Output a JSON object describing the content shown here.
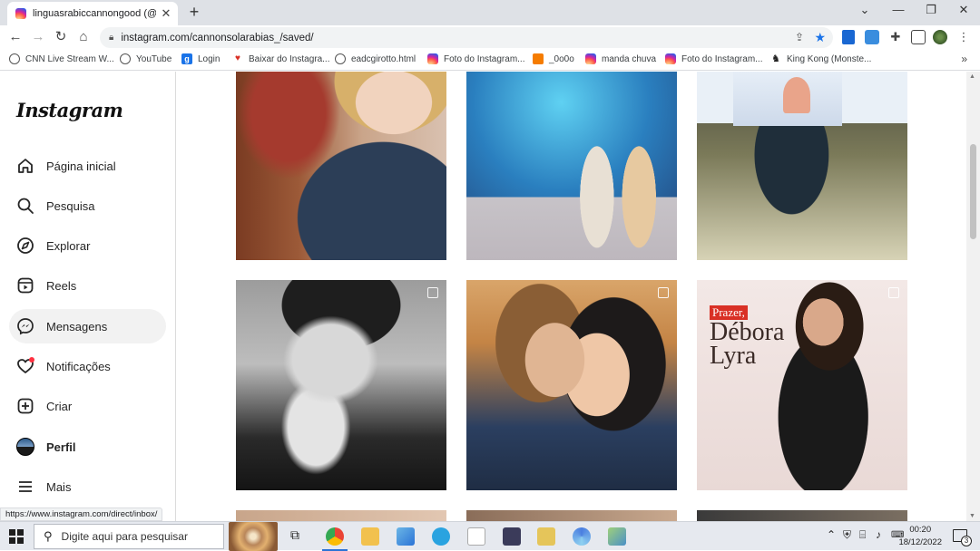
{
  "browser": {
    "tab_title": "linguasrabiccannongood (@cannonsolarabias_)",
    "tab_close": "✕",
    "new_tab": "+",
    "url": "instagram.com/cannonsolarabias_/saved/",
    "status_url": "https://www.instagram.com/direct/inbox/",
    "bookmarks": [
      {
        "label": "CNN Live Stream W...",
        "icon": "globe"
      },
      {
        "label": "YouTube",
        "icon": "globe"
      },
      {
        "label": "Login",
        "icon": "blue-g"
      },
      {
        "label": "Baixar do Instagra...",
        "icon": "heart-red"
      },
      {
        "label": "eadcgirotto.html",
        "icon": "globe"
      },
      {
        "label": "Foto do Instagram...",
        "icon": "instagram"
      },
      {
        "label": "_0o0o",
        "icon": "blogger"
      },
      {
        "label": "manda chuva",
        "icon": "instagram"
      },
      {
        "label": "Foto do Instagram...",
        "icon": "instagram"
      },
      {
        "label": "King Kong (Monste...",
        "icon": "gorilla"
      }
    ]
  },
  "sidebar": {
    "logo": "Instagram",
    "items": [
      {
        "label": "Página inicial",
        "icon": "home-icon"
      },
      {
        "label": "Pesquisa",
        "icon": "search-icon"
      },
      {
        "label": "Explorar",
        "icon": "compass-icon"
      },
      {
        "label": "Reels",
        "icon": "reels-icon"
      },
      {
        "label": "Mensagens",
        "icon": "messenger-icon",
        "active": true
      },
      {
        "label": "Notificações",
        "icon": "heart-icon"
      },
      {
        "label": "Criar",
        "icon": "plus-square-icon"
      },
      {
        "label": "Perfil",
        "icon": "avatar"
      },
      {
        "label": "Mais",
        "icon": "menu-icon"
      }
    ]
  },
  "posts": [
    {
      "subject": "woman-on-sofa"
    },
    {
      "subject": "tv-studio-two-women"
    },
    {
      "subject": "screen-photo"
    },
    {
      "subject": "man-praying-bw"
    },
    {
      "subject": "couple-embrace"
    },
    {
      "subject": "debora-lyra-poster",
      "caption_1": "Prazer,",
      "caption_2": "Débora",
      "caption_3": "Lyra"
    }
  ],
  "taskbar": {
    "search_placeholder": "Digite aqui para pesquisar",
    "time": "00:20",
    "date": "18/12/2022",
    "notifications": "3"
  }
}
